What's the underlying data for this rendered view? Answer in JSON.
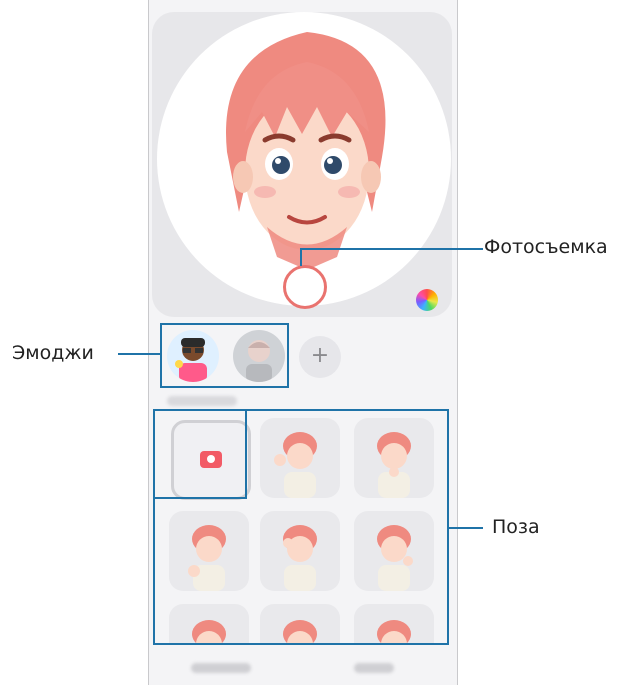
{
  "annotations": {
    "photo_label": "Фотосъемка",
    "emoji_label": "Эмоджи",
    "pose_label": "Поза"
  },
  "controls": {
    "add_symbol": "+"
  },
  "colors": {
    "highlight": "#1f73a8",
    "shutter_ring": "#e9736f",
    "camera_icon": "#f25b66",
    "avatar_hair": "#f08f86"
  }
}
